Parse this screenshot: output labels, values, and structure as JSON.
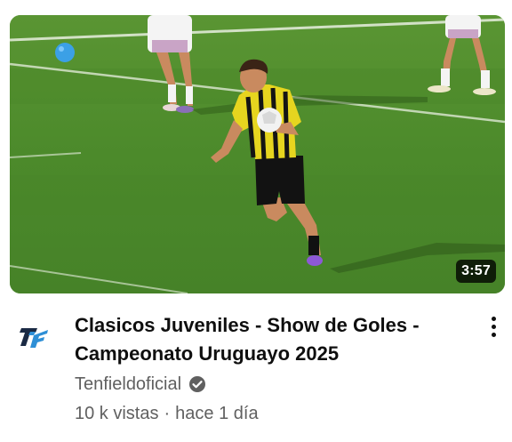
{
  "video": {
    "duration": "3:57",
    "title": "Clasicos Juveniles - Show de Goles - Campeonato Uruguayo 2025",
    "channel": "Tenfieldoficial",
    "views": "10 k vistas",
    "separator": "·",
    "age": "hace 1 día"
  },
  "colors": {
    "pitch": "#4f8a2c",
    "jersey_yellow": "#e6d51f",
    "title_text": "#0f0f0f",
    "secondary_text": "#606060"
  },
  "icons": {
    "channel_avatar": "tenfield-logo",
    "verified": "verified-check-icon",
    "menu": "more-vert-icon"
  }
}
